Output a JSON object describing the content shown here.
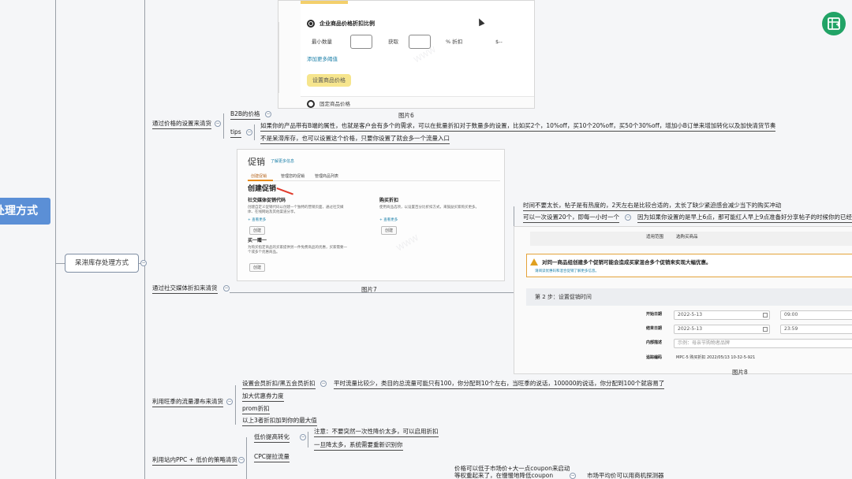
{
  "root": {
    "label": "处理方式"
  },
  "branch": {
    "label": "呆滞库存处理方式"
  },
  "sections": {
    "price_settings": "通过价格的设置来清货",
    "social_discount": "通过社交媒体折扣来清货",
    "prime_day": "利用旺季的流量瀑布来清货",
    "ppc": "利用站内PPC + 低价的策略清货"
  },
  "b2b": {
    "label": "B2B的价格",
    "tips_label": "tips",
    "tip1": "如果你的产品带有B端的属性，也就是客户会有多个的需求，可以在批量折扣对于数量多的设置，比如买2个，10%off，买10个20%off，买50个30%off，增加小B订单来增加转化以及加快清货节奏",
    "tip2": "不是呆滞库存，也可以设置这个价格，只要你设置了就会多一个流量入口"
  },
  "fig6": {
    "caption": "图片6",
    "option1": "企业商品价格折扣比例",
    "min_qty": "最小数量",
    "get": "获取",
    "pct_off": "% 折扣",
    "dollar": "$--",
    "add_more": "添加更多阈值",
    "set_price_button": "设置商品价格",
    "option2": "固定商品价格"
  },
  "fig7": {
    "caption": "图片7",
    "title": "促销",
    "learn_more": "了解更多信息",
    "tab1": "创建促销",
    "tab2": "管理您的促销",
    "tab3": "管理商品列表",
    "heading": "创建促销",
    "card1_title": "社交媒体促销代码",
    "card1_desc": "创建自定义促销代码以创建一个独特的营销页面，通过社交媒体、在线网站及其他渠道分享。",
    "card1_more": "+ 查看更多",
    "card1_btn": "创建",
    "card2_title": "购买折扣",
    "card2_desc": "使用商品选项，以设置百分比折扣方式，来鼓励买家购买更多。",
    "card2_more": "+ 查看更多",
    "card2_btn": "创建",
    "card3_title": "买一赠一",
    "card3_desc": "为购买指定商品的买家提供另一件免费商品的优惠，买家需要一个或多个优惠商品。",
    "card3_btn": "创建"
  },
  "social": {
    "note1": "时间不要太长，帖子是有热度的，2天左右是比较合适的，太长了缺少紧迫感会减少当下的购买冲动",
    "note2": "可以一次设置20个，即每一小时一个",
    "note3": "因为如果你设置的是早上6点，那可能红人早上9点准备好分享帖子的时候你的已经"
  },
  "fig8": {
    "caption": "图片8",
    "scope_label": "适用范围",
    "scope_value": "选购买商品",
    "warning": "对同一商品组创建多个促销可能会造成买家混合多个促销来实现大幅优惠。",
    "warning_sub": "请阅读优惠码和混合促销了解更多信息。",
    "step": "第 2 步：设置促销时间",
    "start_label": "开始日期",
    "start_date": "2022-5-13",
    "start_time": "09:00",
    "end_label": "结束日期",
    "end_date": "2022-5-13",
    "end_time": "23:59",
    "internal_label": "内部描述",
    "internal_ph": "示例：母亲节购物者品牌",
    "tracking_label": "追踪编码",
    "tracking_value": "MPC-5 购买折扣 2022/05/13 10-32-5-921"
  },
  "prime": {
    "item1": "设置会员折扣/黑五会员折扣",
    "item1_note": "平时流量比较少，类目的总流量可能只有100，你分配到10个左右，当旺季的说话，100000的说话，你分配到100个就容易了",
    "item2": "加大优惠券力度",
    "item3": "prom折扣",
    "item4": "以上3者折扣加到你的最大值"
  },
  "ppc": {
    "item1": "低价提高转化",
    "item1_note1": "注意：不要突然一次性降价太多，可以启用折扣",
    "item1_note2": "一旦降太多，系统需要重新识别你",
    "item2": "CPC提拉流量",
    "bottom_note1": "价格可以低于市场价+大一点coupon来启动",
    "bottom_note2": "等权重起来了，在慢慢地降低coupon",
    "bottom_note3": "市场平均价可以用商机探测器"
  },
  "colors": {
    "root": "#5b8fd6",
    "sheet_icon": "#21a366",
    "link": "#1a7fa8"
  }
}
